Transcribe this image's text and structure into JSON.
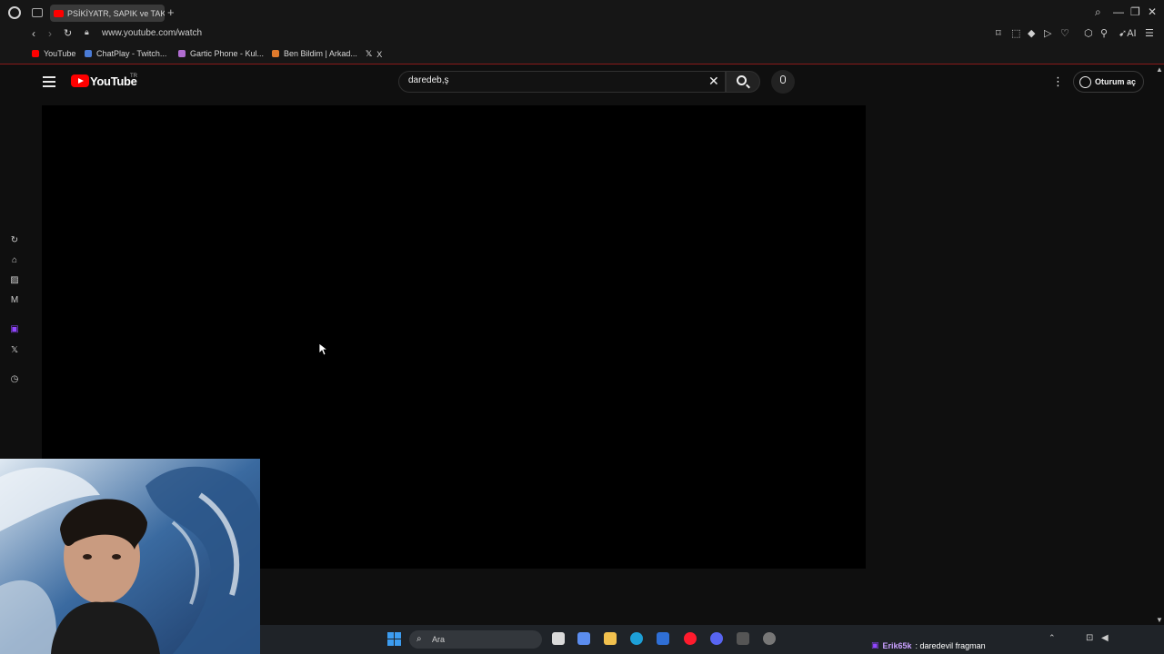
{
  "browser": {
    "active_tab_title": "PSİKİYATR, SAPIK ve TAKI",
    "new_tab": "+",
    "url": "www.youtube.com/watch",
    "bookmarks": [
      {
        "label": "YouTube",
        "color": "#ff0000"
      },
      {
        "label": "ChatPlay - Twitch...",
        "color": "#4a7bd6"
      },
      {
        "label": "Gartic Phone - Kul...",
        "color": "#b06cd0"
      },
      {
        "label": "Ben Bildim | Arkad...",
        "color": "#e07a2c"
      },
      {
        "label": "X",
        "color": "#e8e8e8"
      }
    ]
  },
  "youtube": {
    "logo_text": "YouTube",
    "region": "TR",
    "search_value": "daredeb,ş",
    "signin_label": "Oturum aç"
  },
  "taskbar": {
    "search_label": "Ara",
    "notice_user": "Erik65k",
    "notice_text": ": daredevil fragman"
  },
  "colors": {
    "background": "#0f0f0f",
    "accent": "#ff0000",
    "taskbar": "#1f2328"
  }
}
